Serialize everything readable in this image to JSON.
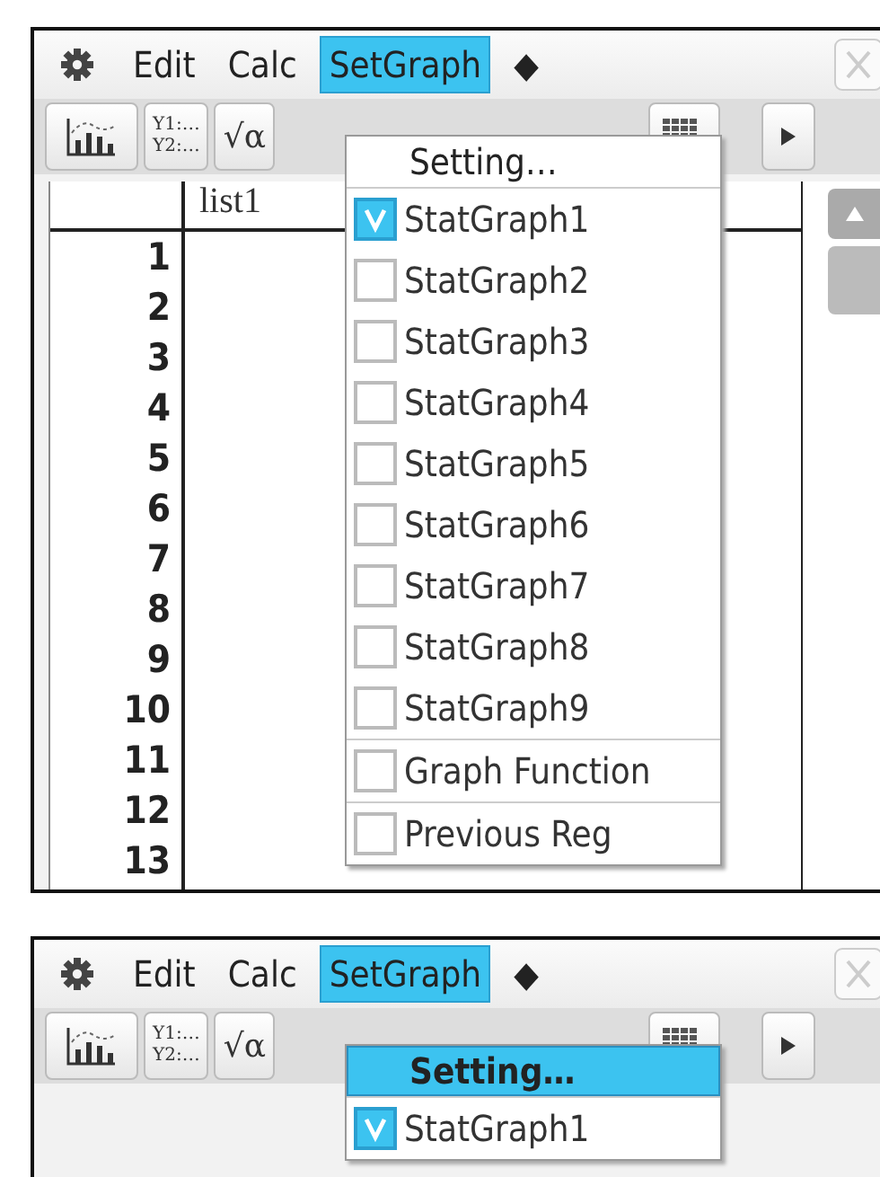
{
  "screens": [
    {
      "menu_bar": {
        "items": [
          {
            "kind": "gear",
            "selected": false
          },
          {
            "kind": "text",
            "label": "Edit",
            "selected": false
          },
          {
            "kind": "text",
            "label": "Calc",
            "selected": false
          },
          {
            "kind": "text",
            "label": "SetGraph",
            "selected": true
          },
          {
            "kind": "text",
            "label": "◆",
            "selected": false
          }
        ]
      },
      "toolbar": [
        {
          "kind": "graph"
        },
        {
          "kind": "text",
          "lines": [
            "Y1:…",
            "Y2:…"
          ]
        },
        {
          "kind": "text",
          "lines": [
            "√α"
          ]
        },
        {
          "kind": "grid"
        },
        {
          "kind": "next"
        }
      ],
      "table": {
        "header": "list1",
        "row_numbers": [
          "1",
          "2",
          "3",
          "4",
          "5",
          "6",
          "7",
          "8",
          "9",
          "10",
          "11",
          "12",
          "13"
        ]
      },
      "dropdown": {
        "sections": [
          [
            {
              "kind": "action",
              "label": "Setting…",
              "highlighted": false
            }
          ],
          [
            {
              "kind": "check",
              "label": "StatGraph1",
              "checked": true
            },
            {
              "kind": "check",
              "label": "StatGraph2",
              "checked": false
            },
            {
              "kind": "check",
              "label": "StatGraph3",
              "checked": false
            },
            {
              "kind": "check",
              "label": "StatGraph4",
              "checked": false
            },
            {
              "kind": "check",
              "label": "StatGraph5",
              "checked": false
            },
            {
              "kind": "check",
              "label": "StatGraph6",
              "checked": false
            },
            {
              "kind": "check",
              "label": "StatGraph7",
              "checked": false
            },
            {
              "kind": "check",
              "label": "StatGraph8",
              "checked": false
            },
            {
              "kind": "check",
              "label": "StatGraph9",
              "checked": false
            }
          ],
          [
            {
              "kind": "check",
              "label": "Graph Function",
              "checked": false
            }
          ],
          [
            {
              "kind": "check",
              "label": "Previous Reg",
              "checked": false
            }
          ]
        ]
      }
    },
    {
      "menu_bar": {
        "items": [
          {
            "kind": "gear",
            "selected": false
          },
          {
            "kind": "text",
            "label": "Edit",
            "selected": false
          },
          {
            "kind": "text",
            "label": "Calc",
            "selected": false
          },
          {
            "kind": "text",
            "label": "SetGraph",
            "selected": true
          },
          {
            "kind": "text",
            "label": "◆",
            "selected": false
          }
        ]
      },
      "toolbar": [
        {
          "kind": "graph"
        },
        {
          "kind": "text",
          "lines": [
            "Y1:…",
            "Y2:…"
          ]
        },
        {
          "kind": "text",
          "lines": [
            "√α"
          ]
        },
        {
          "kind": "grid"
        },
        {
          "kind": "next"
        }
      ],
      "dropdown": {
        "sections": [
          [
            {
              "kind": "action",
              "label": "Setting…",
              "highlighted": true
            }
          ],
          [
            {
              "kind": "check",
              "label": "StatGraph1",
              "checked": true
            }
          ]
        ]
      }
    }
  ]
}
